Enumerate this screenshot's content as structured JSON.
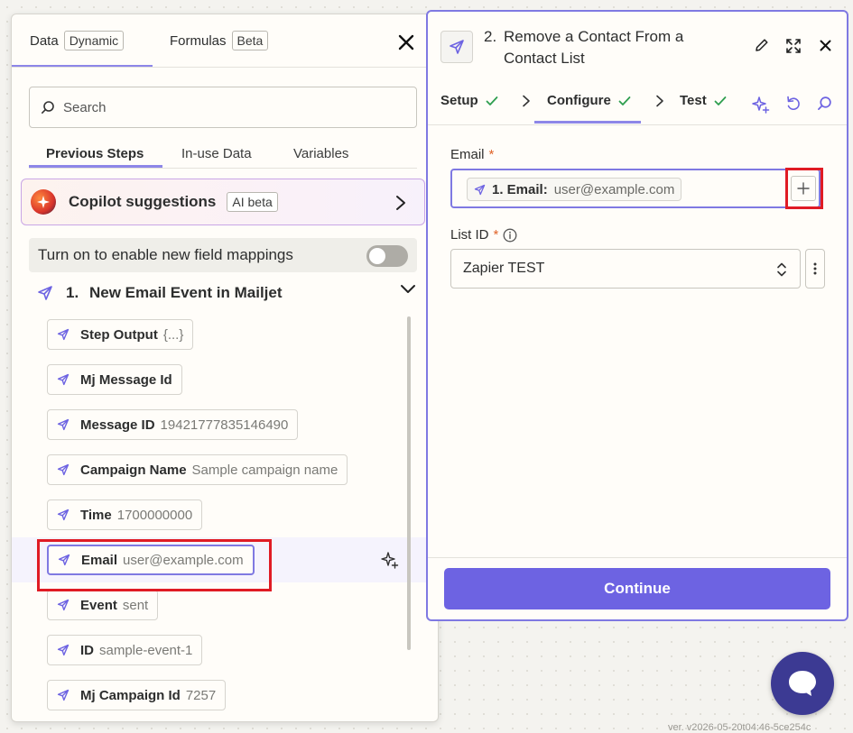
{
  "data_panel": {
    "tabs": [
      {
        "label": "Data",
        "badge": "Dynamic"
      },
      {
        "label": "Formulas",
        "badge": "Beta"
      }
    ],
    "search_placeholder": "Search",
    "sub_tabs": [
      "Previous Steps",
      "In-use Data",
      "Variables"
    ],
    "copilot": {
      "title": "Copilot suggestions",
      "badge": "AI beta"
    },
    "toggle": {
      "label": "Turn on to enable new field mappings",
      "on": false
    },
    "step": {
      "number": "1.",
      "name": "New Email Event in Mailjet"
    },
    "fields": [
      {
        "label": "Step Output",
        "value": "{...}"
      },
      {
        "label": "Mj Message Id",
        "value": ""
      },
      {
        "label": "Message ID",
        "value": "19421777835146490"
      },
      {
        "label": "Campaign Name",
        "value": "Sample campaign name"
      },
      {
        "label": "Time",
        "value": "1700000000"
      },
      {
        "label": "Email",
        "value": "user@example.com"
      },
      {
        "label": "Event",
        "value": "sent"
      },
      {
        "label": "ID",
        "value": "sample-event-1"
      },
      {
        "label": "Mj Campaign Id",
        "value": "7257"
      }
    ]
  },
  "step_panel": {
    "step_number": "2.",
    "step_title": "Remove a Contact From a Contact List",
    "tabs": [
      {
        "label": "Setup",
        "complete": true
      },
      {
        "label": "Configure",
        "complete": true
      },
      {
        "label": "Test",
        "complete": true
      }
    ],
    "email_field": {
      "label": "Email",
      "required_mark": "*",
      "token_label": "1. Email:",
      "token_value": "user@example.com"
    },
    "list_field": {
      "label": "List ID",
      "required_mark": "*",
      "value": "Zapier TEST"
    },
    "continue_label": "Continue"
  },
  "version_text": "ver. v2026-05-20t04:46-5ce254c",
  "colors": {
    "accent": "#7f79e2",
    "primary_button": "#6d63e2",
    "highlight": "#e01b24",
    "check": "#2e9e4f",
    "chat_button": "#3c3a93"
  }
}
